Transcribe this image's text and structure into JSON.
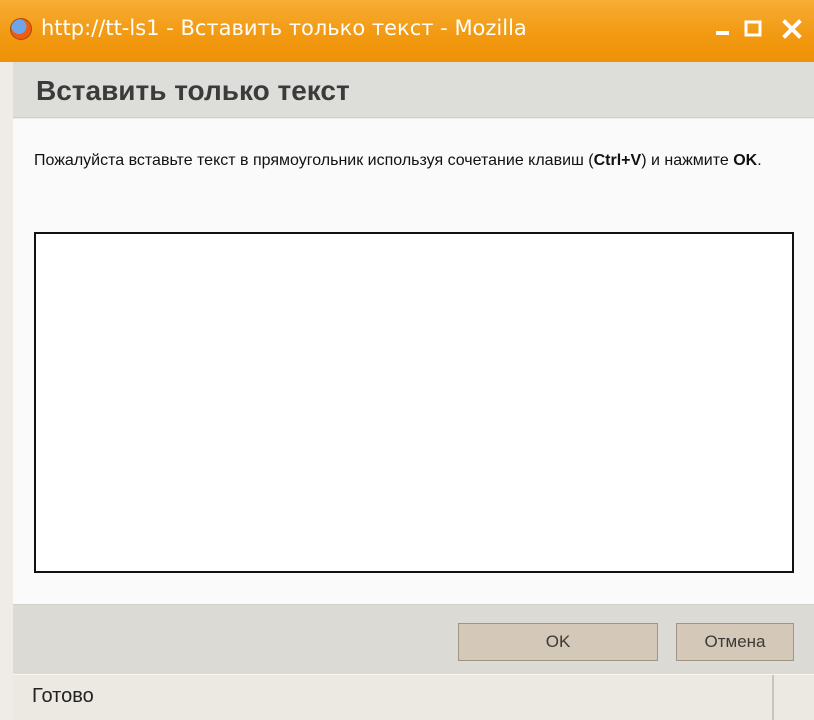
{
  "window": {
    "title": "http://tt-ls1 - Вставить только текст - Mozilla"
  },
  "dialog": {
    "heading": "Вставить только текст",
    "instruction_parts": {
      "before_shortcut": "Пожалуйста вставьте текст в прямоугольник используя сочетание клавиш (",
      "shortcut": "Ctrl+V",
      "between": ") и нажмите ",
      "ok_word": "OK",
      "after": "."
    },
    "textarea_value": ""
  },
  "buttons": {
    "ok": "OK",
    "cancel": "Отмена"
  },
  "status": {
    "text": "Готово"
  },
  "colors": {
    "titlebar": "#f29a12",
    "header": "#ddddda",
    "button": "#d4c8b8"
  },
  "icons": {
    "app": "firefox-icon",
    "minimize": "minimize-icon",
    "maximize": "maximize-icon",
    "close": "close-icon"
  }
}
